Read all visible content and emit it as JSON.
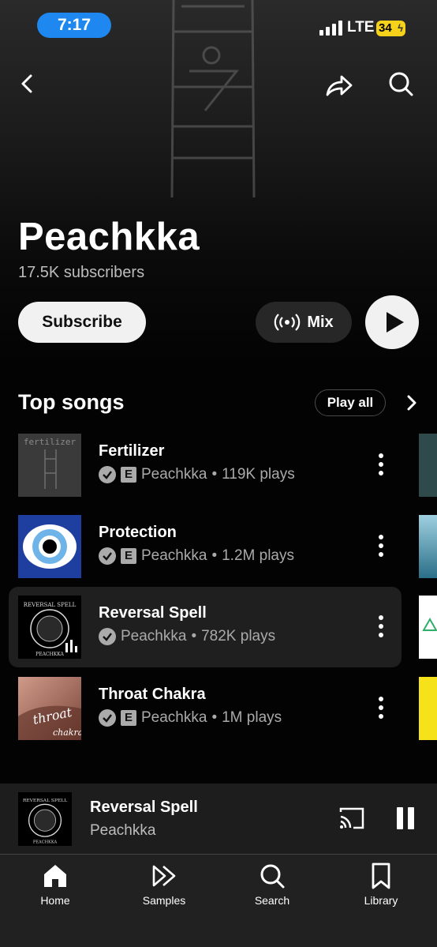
{
  "status_bar": {
    "time": "7:17",
    "network": "LTE",
    "battery": "34"
  },
  "artist": {
    "name": "Peachkka",
    "subscribers": "17.5K subscribers"
  },
  "actions": {
    "subscribe": "Subscribe",
    "mix": "Mix"
  },
  "top_songs": {
    "title": "Top songs",
    "play_all": "Play all",
    "songs": [
      {
        "title": "Fertilizer",
        "artist": "Peachkka",
        "plays": "119K plays",
        "explicit": true
      },
      {
        "title": "Protection",
        "artist": "Peachkka",
        "plays": "1.2M plays",
        "explicit": true
      },
      {
        "title": "Reversal Spell",
        "artist": "Peachkka",
        "plays": "782K plays",
        "explicit": false,
        "playing": true
      },
      {
        "title": "Throat Chakra",
        "artist": "Peachkka",
        "plays": "1M plays",
        "explicit": true
      }
    ],
    "separator": "•",
    "explicit_badge": "E",
    "thumb_text": {
      "fertilizer": "fertilizer",
      "reversal": "REVERSAL SPELL",
      "reversal_sub": "PEACHKKA",
      "throat_1": "throat",
      "throat_2": "chakra"
    }
  },
  "now_playing": {
    "title": "Reversal Spell",
    "artist": "Peachkka"
  },
  "tabs": [
    {
      "label": "Home",
      "icon": "home-icon"
    },
    {
      "label": "Samples",
      "icon": "samples-icon"
    },
    {
      "label": "Search",
      "icon": "search-icon"
    },
    {
      "label": "Library",
      "icon": "library-icon"
    }
  ],
  "colors": {
    "accent_time": "#1e88f0",
    "battery": "#f7d21a",
    "eye_blue": "#1f3fa0"
  }
}
